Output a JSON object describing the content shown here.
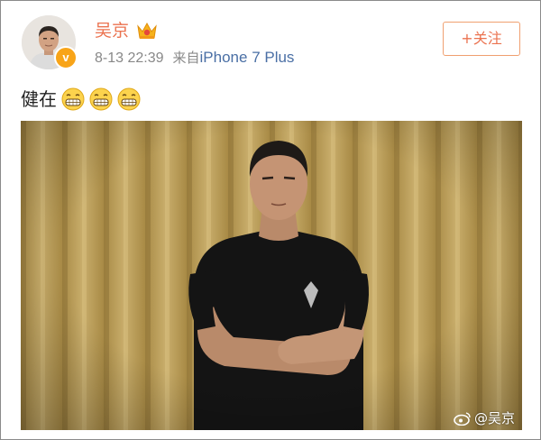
{
  "post": {
    "author": {
      "name": "吴京",
      "verified_mark": "v",
      "avatar_icon": "avatar-photo",
      "badge_icon": "vip-crown-icon"
    },
    "date": "8-13 22:39",
    "source_label": "来自",
    "source_device": "iPhone 7 Plus",
    "follow_button": "+关注",
    "text": "健在",
    "emoji_icons": [
      "grin-emoji",
      "grin-emoji",
      "grin-emoji"
    ],
    "photo": {
      "subject": "man-in-black-tshirt-arms-crossed",
      "watermark": "@吴京",
      "watermark_icon": "weibo-logo-icon"
    }
  },
  "colors": {
    "name": "#eb7350",
    "meta": "#888888",
    "device_link": "#4a6fa5",
    "follow_border": "#f0a070",
    "curtain": "#b79c55"
  }
}
